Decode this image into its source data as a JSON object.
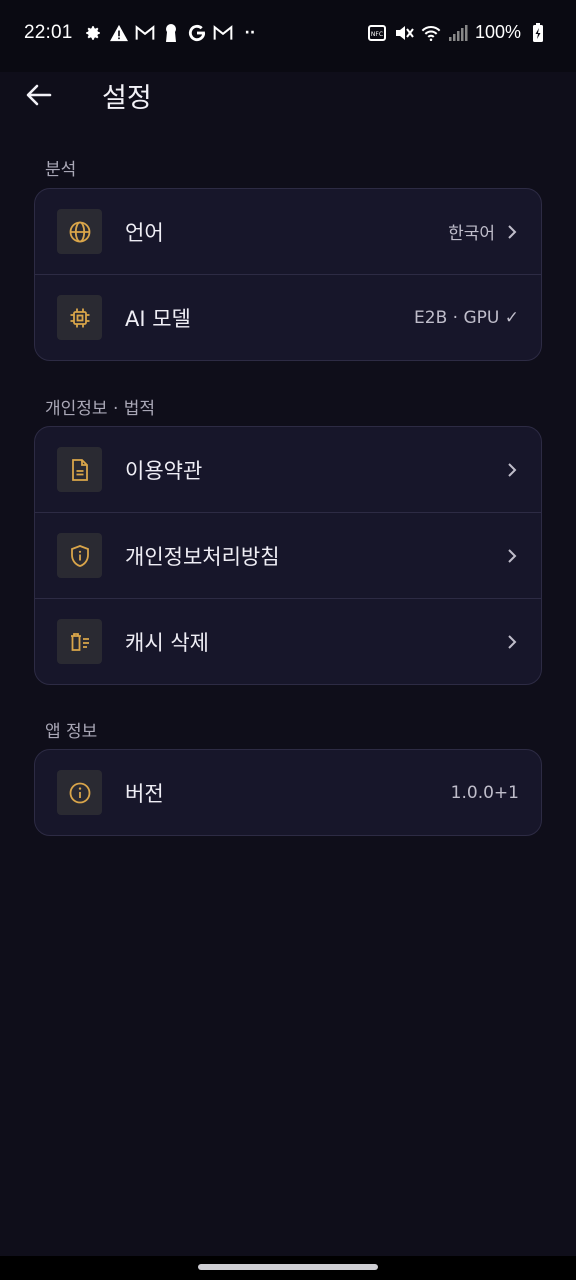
{
  "status_bar": {
    "time": "22:01",
    "battery": "100%",
    "more": "··"
  },
  "header": {
    "title": "설정"
  },
  "sections": [
    {
      "label": "분석",
      "items": [
        {
          "label": "언어",
          "value": "한국어",
          "icon": "globe-icon",
          "chevron": true
        },
        {
          "label": "AI 모델",
          "value": "E2B · GPU ✓",
          "icon": "chip-icon",
          "chevron": false
        }
      ]
    },
    {
      "label": "개인정보 · 법적",
      "items": [
        {
          "label": "이용약관",
          "icon": "document-icon",
          "chevron": true
        },
        {
          "label": "개인정보처리방침",
          "icon": "shield-info-icon",
          "chevron": true
        },
        {
          "label": "캐시 삭제",
          "icon": "clear-cache-icon",
          "chevron": true
        }
      ]
    },
    {
      "label": "앱 정보",
      "items": [
        {
          "label": "버전",
          "value": "1.0.0+1",
          "icon": "info-icon",
          "chevron": false
        }
      ]
    }
  ],
  "colors": {
    "background": "#0f0e1a",
    "card": "#17162a",
    "accent": "#d9a54a",
    "border": "#2d2b44"
  }
}
